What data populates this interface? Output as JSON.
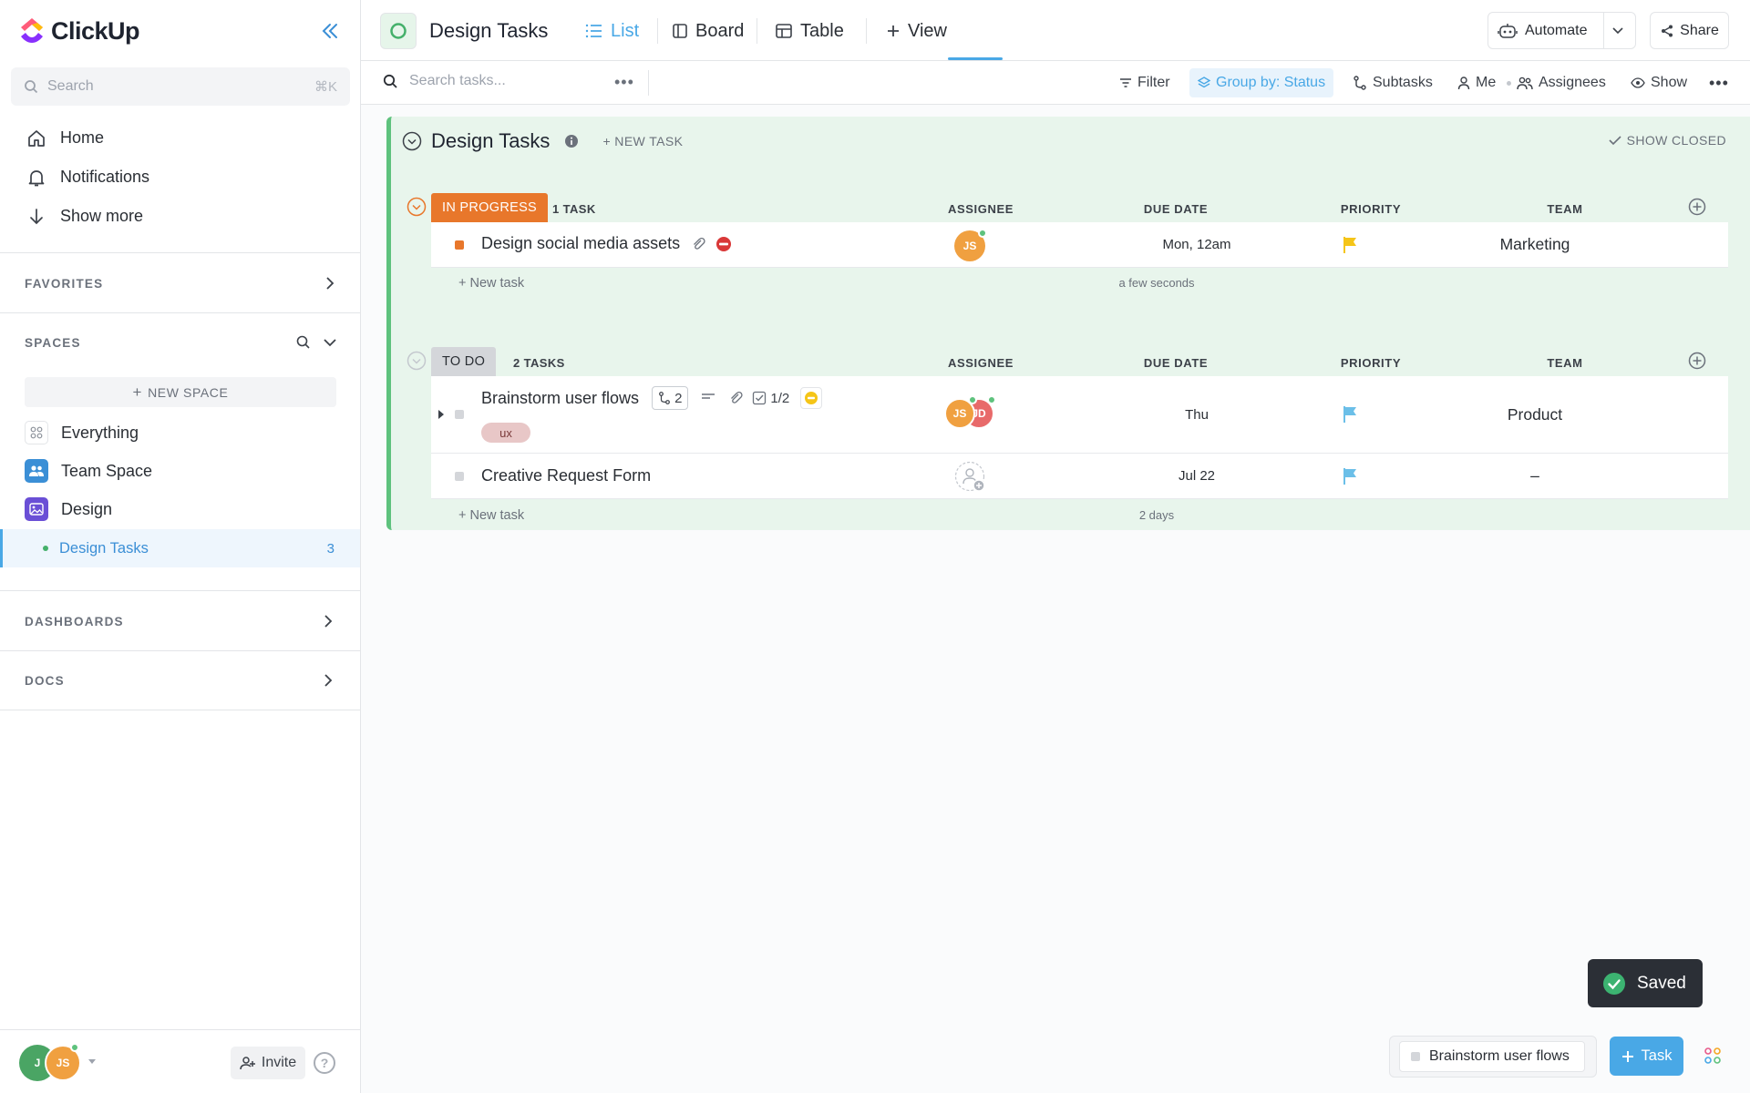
{
  "app": {
    "name": "ClickUp"
  },
  "sidebar": {
    "search_placeholder": "Search",
    "search_shortcut": "⌘K",
    "nav": [
      {
        "label": "Home",
        "icon": "home-icon"
      },
      {
        "label": "Notifications",
        "icon": "bell-icon"
      },
      {
        "label": "Show more",
        "icon": "arrow-down-icon"
      }
    ],
    "favorites_label": "FAVORITES",
    "spaces_label": "SPACES",
    "new_space_label": "NEW SPACE",
    "spaces": [
      {
        "label": "Everything",
        "icon": "grid-icon"
      },
      {
        "label": "Team Space",
        "icon": "team-icon",
        "color": "#3b8fd6"
      },
      {
        "label": "Design",
        "icon": "image-icon",
        "color": "#6a4fd6"
      }
    ],
    "active_list": {
      "label": "Design Tasks",
      "count": "3"
    },
    "dashboards_label": "DASHBOARDS",
    "docs_label": "DOCS",
    "footer": {
      "avatar_1": "J",
      "avatar_2": "JS",
      "invite_label": "Invite",
      "help_label": "?"
    }
  },
  "topbar": {
    "title": "Design Tasks",
    "tabs": [
      {
        "label": "List",
        "icon": "list-icon",
        "active": true
      },
      {
        "label": "Board",
        "icon": "board-icon"
      },
      {
        "label": "Table",
        "icon": "table-icon"
      },
      {
        "label": "View",
        "icon": "plus-icon"
      }
    ],
    "automate_label": "Automate",
    "share_label": "Share"
  },
  "toolbar": {
    "search_placeholder": "Search tasks...",
    "filter_label": "Filter",
    "group_by_label": "Group by: Status",
    "subtasks_label": "Subtasks",
    "me_label": "Me",
    "assignees_label": "Assignees",
    "show_label": "Show"
  },
  "list": {
    "title": "Design Tasks",
    "new_task_label": "+ NEW TASK",
    "show_closed_label": "SHOW CLOSED",
    "columns": {
      "assignee": "ASSIGNEE",
      "due_date": "DUE DATE",
      "priority": "PRIORITY",
      "team": "TEAM"
    },
    "groups": [
      {
        "status": "IN PROGRESS",
        "status_color": "#e8772b",
        "count_label": "1 TASK",
        "tasks": [
          {
            "name": "Design social media assets",
            "assignee": "JS",
            "due": "Mon, 12am",
            "priority_color": "#f5c518",
            "team": "Marketing"
          }
        ],
        "new_task_label": "+ New task",
        "ago": "a few seconds"
      },
      {
        "status": "TO DO",
        "status_color": "#d4d6da",
        "count_label": "2 TASKS",
        "tasks": [
          {
            "name": "Brainstorm user flows",
            "subtask_count": "2",
            "checklist": "1/2",
            "tag": "ux",
            "assignees": [
              "JS",
              "JD"
            ],
            "due": "Thu",
            "priority_color": "#6bbfe8",
            "team": "Product"
          },
          {
            "name": "Creative Request Form",
            "assignee": "",
            "due": "Jul 22",
            "priority_color": "#6bbfe8",
            "team": "–"
          }
        ],
        "new_task_label": "+ New task",
        "ago": "2 days"
      }
    ]
  },
  "toast": {
    "label": "Saved"
  },
  "tray": {
    "task_label": "Brainstorm user flows",
    "task_button_label": "Task"
  }
}
